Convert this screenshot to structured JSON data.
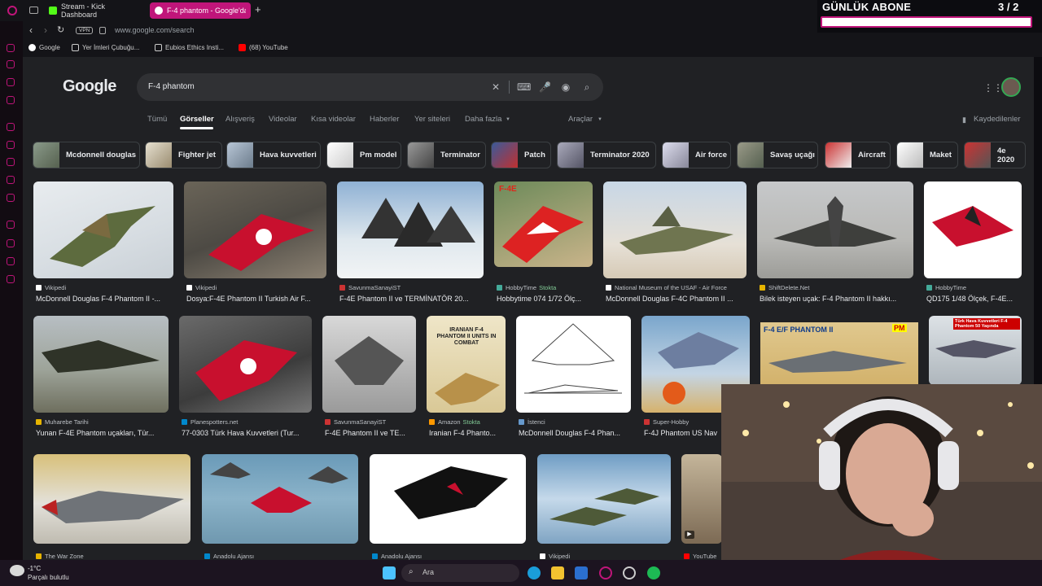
{
  "browser": {
    "tabs": [
      {
        "label": "Stream - Kick Dashboard",
        "color": "#53fc18"
      },
      {
        "label": "F-4 phantom - Google'da",
        "color": "#ffffff"
      }
    ],
    "vpn_label": "VPN",
    "url": "www.google.com/search",
    "bookmarks": [
      "Google",
      "Yer İmleri Çubuğu...",
      "Eubios Ethics Insti...",
      "(68) YouTube"
    ]
  },
  "google": {
    "logo": "Google",
    "query": "F-4 phantom",
    "tabs": [
      "Tümü",
      "Görseller",
      "Alışveriş",
      "Videolar",
      "Kısa videolar",
      "Haberler",
      "Yer siteleri",
      "Daha fazla"
    ],
    "active_tab": "Görseller",
    "tools_label": "Araçlar",
    "saved_label": "Kaydedilenler",
    "chips": [
      "Mcdonnell douglas",
      "Fighter jet",
      "Hava kuvvetleri",
      "Pm model",
      "Terminator",
      "Patch",
      "Terminator 2020",
      "Air force",
      "Savaş uçağı",
      "Aircraft",
      "Maket",
      "4e 2020"
    ],
    "results_row1": [
      {
        "source": "Vikipedi",
        "title": "McDonnell Douglas F-4 Phantom II -..."
      },
      {
        "source": "Vikipedi",
        "title": "Dosya:F-4E Phantom II Turkish Air F..."
      },
      {
        "source": "SavunmaSanayiST",
        "title": "F-4E Phantom II ve TERMİNATÖR 20..."
      },
      {
        "source": "HobbyTime",
        "stock": "Stokta",
        "title": "Hobbytime 074 1/72 Ölç..."
      },
      {
        "source": "National Museum of the USAF - Air Force",
        "title": "McDonnell Douglas F-4C Phantom II ..."
      },
      {
        "source": "ShiftDelete.Net",
        "title": "Bilek isteyen uçak: F-4 Phantom II hakkı..."
      },
      {
        "source": "HobbyTime",
        "title": "QD175 1/48 Ölçek, F-4E..."
      }
    ],
    "results_row2": [
      {
        "source": "Muharebe Tarihi",
        "title": "Yunan F-4E Phantom uçakları, Tür..."
      },
      {
        "source": "Planespotters.net",
        "title": "77-0303 Türk Hava Kuvvetleri (Tur..."
      },
      {
        "source": "SavunmaSanayiST",
        "title": "F-4E Phantom II ve TE..."
      },
      {
        "source": "Amazon",
        "stock": "Stokta",
        "title": "Iranian F-4 Phanto..."
      },
      {
        "source": "İstenci",
        "title": "McDonnell Douglas F-4 Phan..."
      },
      {
        "source": "Super-Hobby",
        "title": "F-4J Phantom US Nav"
      }
    ],
    "results_row3_sources": [
      "The War Zone",
      "Anadolu Ajansı",
      "Anadolu Ajansı",
      "Vikipedi",
      "YouTube"
    ],
    "image_texts": {
      "book_title": "IRANIAN F-4 PHANTOM II UNITS IN COMBAT",
      "model_box": "F-4 E/F PHANTOM II",
      "model_brand": "PM",
      "banner": "Türk Hava Kuvvetleri F-4 Phantom 50 Yaşında",
      "f4e_label": "F-4E"
    }
  },
  "overlay": {
    "title": "GÜNLÜK ABONE",
    "count": "3 / 2"
  },
  "taskbar": {
    "weather_temp": "-1°C",
    "weather_desc": "Parçalı bulutlu",
    "search_placeholder": "Ara"
  }
}
